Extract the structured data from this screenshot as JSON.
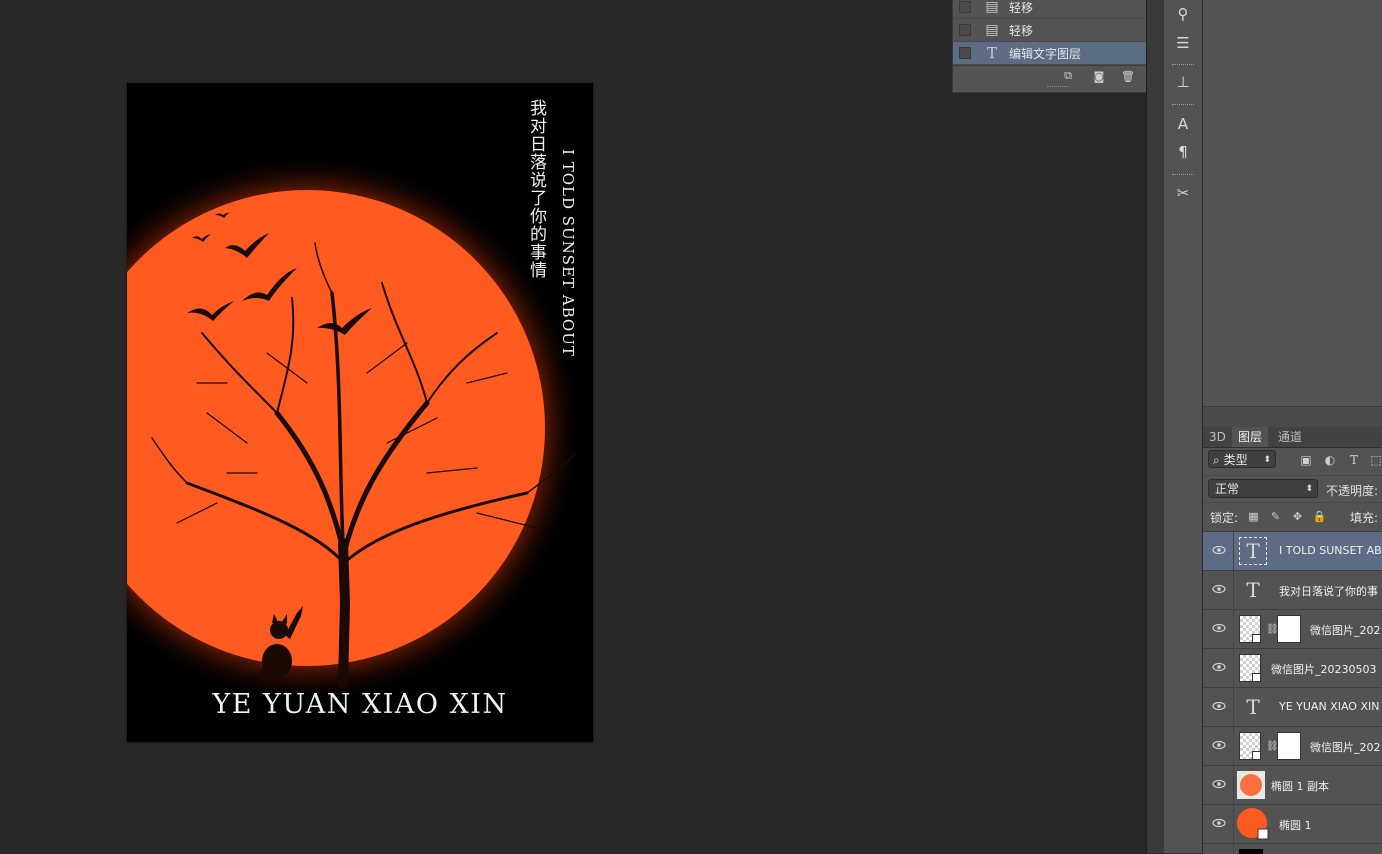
{
  "artwork": {
    "title_zh": "我对日落说了你的事情",
    "title_en": "I TOLD SUNSET ABOUT",
    "signature": "YE YUAN XIAO XIN",
    "colors": {
      "sun": "#ff5a1f",
      "glow": "#c2330a",
      "background": "#000000",
      "silhouette": "#1a0a04"
    }
  },
  "history": {
    "items": [
      {
        "label": "轻移",
        "icon": "document-icon",
        "active": false
      },
      {
        "label": "轻移",
        "icon": "document-icon",
        "active": false
      },
      {
        "label": "编辑文字图层",
        "icon": "type-tool-icon",
        "active": true
      }
    ]
  },
  "layers_panel": {
    "tabs": [
      "3D",
      "图层",
      "通道"
    ],
    "active_tab": "图层",
    "filter_kind": "类型",
    "blend_mode": "正常",
    "opacity_label": "不透明度:",
    "lock_label": "锁定:",
    "fill_label": "填充:",
    "layers": [
      {
        "name": "I TOLD SUNSET ABOUT",
        "kind": "text",
        "selected": true
      },
      {
        "name": "我对日落说了你的事",
        "kind": "text",
        "selected": false
      },
      {
        "name": "微信图片_202",
        "kind": "smart-object-masked",
        "selected": false
      },
      {
        "name": "微信图片_20230503",
        "kind": "smart-object",
        "selected": false
      },
      {
        "name": "YE YUAN XIAO XIN",
        "kind": "text",
        "selected": false
      },
      {
        "name": "微信图片_202",
        "kind": "smart-object-masked",
        "selected": false
      },
      {
        "name": "椭圆 1 副本",
        "kind": "shape-blur",
        "selected": false
      },
      {
        "name": "椭圆 1",
        "kind": "shape",
        "selected": false
      }
    ]
  }
}
